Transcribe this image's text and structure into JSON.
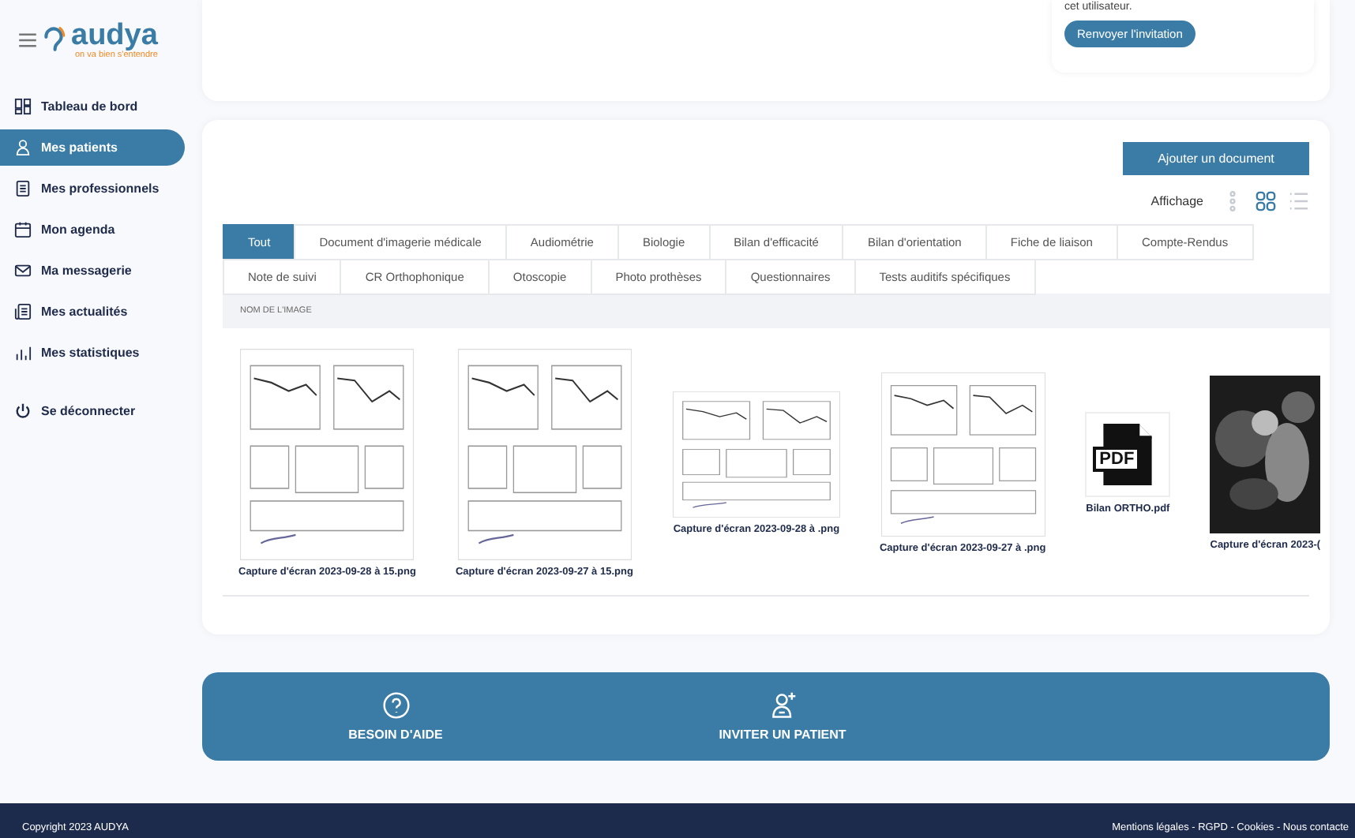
{
  "logo": {
    "name": "audya",
    "tagline": "on va bien s'entendre"
  },
  "sidebar": {
    "items": [
      {
        "label": "Tableau de bord",
        "kind": "dashboard",
        "selected": false
      },
      {
        "label": "Mes patients",
        "kind": "patient",
        "selected": true
      },
      {
        "label": "Mes professionnels",
        "kind": "book",
        "selected": false
      },
      {
        "label": "Mon agenda",
        "kind": "calendar",
        "selected": false
      },
      {
        "label": "Ma messagerie",
        "kind": "mail",
        "selected": false
      },
      {
        "label": "Mes actualités",
        "kind": "news",
        "selected": false
      },
      {
        "label": "Mes statistiques",
        "kind": "stats",
        "selected": false
      }
    ],
    "logout": "Se déconnecter"
  },
  "invitation": {
    "text": "cet utilisateur.",
    "button": "Renvoyer l'invitation"
  },
  "documents": {
    "add_button": "Ajouter un document",
    "display_label": "Affichage",
    "views": [
      {
        "kind": "dots",
        "selected": false
      },
      {
        "kind": "grid",
        "selected": true
      },
      {
        "kind": "list",
        "selected": false
      }
    ],
    "tabs": [
      {
        "label": "Tout",
        "selected": true
      },
      {
        "label": "Document d'imagerie médicale",
        "selected": false
      },
      {
        "label": "Audiométrie",
        "selected": false
      },
      {
        "label": "Biologie",
        "selected": false
      },
      {
        "label": "Bilan d'efficacité",
        "selected": false
      },
      {
        "label": "Bilan d'orientation",
        "selected": false
      },
      {
        "label": "Fiche de liaison",
        "selected": false
      },
      {
        "label": "Compte-Rendus",
        "selected": false
      },
      {
        "label": "Note de suivi",
        "selected": false
      },
      {
        "label": "CR Orthophonique",
        "selected": false
      },
      {
        "label": "Otoscopie",
        "selected": false
      },
      {
        "label": "Photo prothèses",
        "selected": false
      },
      {
        "label": "Questionnaires",
        "selected": false
      },
      {
        "label": "Tests auditifs spécifiques",
        "selected": false
      }
    ],
    "column": "NOM DE L'IMAGE",
    "files": [
      {
        "name": "Capture d'écran 2023-09-28 à 15.png",
        "kind": "picture"
      },
      {
        "name": "Capture d'écran 2023-09-27 à 15.png",
        "kind": "picture"
      },
      {
        "name": "Capture d'écran 2023-09-28 à .png",
        "kind": "picture"
      },
      {
        "name": "Capture d'écran 2023-09-27 à .png",
        "kind": "picture"
      },
      {
        "name": "Bilan ORTHO.pdf",
        "kind": "pdf",
        "badge": "PDF"
      },
      {
        "name": "Capture d'écran 2023-(",
        "kind": "picture"
      }
    ]
  },
  "actions": [
    {
      "label": "BESOIN D'AIDE",
      "kind": "help"
    },
    {
      "label": "INVITER UN PATIENT",
      "kind": "invite"
    }
  ],
  "footer": {
    "copyright": "Copyright 2023 AUDYA",
    "links": "Mentions légales - RGPD - Cookies - Nous contacte"
  }
}
